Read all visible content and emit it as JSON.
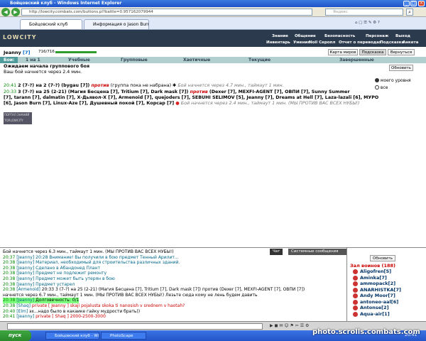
{
  "window": {
    "title": "Бойцовский клуб - Windows Internet Explorer"
  },
  "address": {
    "url": "http://lowcity.combats.com/buttons.pl?battle=0.957162079944",
    "search_placeholder": "Яндекс"
  },
  "tabs": [
    {
      "label": "Бойцовский клуб"
    },
    {
      "label": "Информация о Jason Burn"
    }
  ],
  "game": {
    "logo": "LOWCITY",
    "top_links": [
      "Знание",
      "Общение",
      "Безопасность",
      "Персонаж",
      "Выход",
      "Инвентарь",
      "Умения",
      "Noil Серопл",
      "Отчет о переводах",
      "Подсказка",
      "Анкета"
    ],
    "player": {
      "name": "Jeanny",
      "level": "[7]",
      "hp": "716/716",
      "hp_fraction": 1.0
    },
    "buttons": {
      "map": "Карта миров",
      "hint": "Подсказка",
      "back": "Вернуться",
      "refresh": "Обновить"
    },
    "fight_tabs": [
      "Бои:",
      "1 на 1",
      "Учебные",
      "Групповые",
      "Хаотичные",
      "Текущие",
      "Завершенные"
    ],
    "status_title": "Ожидаем начала группового боя",
    "status_sub": "Ваш бой начнется через 2.4 мин.",
    "radio": {
      "opt1": "моего уровня",
      "opt2": "все"
    },
    "battle1": {
      "time": "20:41",
      "text": "2 (7-?) на 2 (7-?) (bygau [7]) ",
      "against": "против",
      "rest": " (группа пока не набрана) ",
      "timer": "Бой начнется через 4.7 мин., таймаут 1 мин."
    },
    "battle2_l1": {
      "time": "20:33",
      "text": "3 (7-?) на 25 (2-21) (Магия Бесцена [7], Tritium [7], Dark mask [7]) ",
      "against": "против",
      "rest": " (Dexer [7], MEXFI-AGENT [7], ОВПИ [7], Sunny Summer"
    },
    "battle2_l2": "[7], tarann [7], dalmatin [7], Х-Дьявол-Х [7], Armenoid [7], quejoders [7], SEBUHI SELIMOV [5], Jeanny [7], Dreams at Hell [7], Laza-lazali [6], МУРО",
    "battle2_l3": {
      "text": "[6], Jason Burn [7], Linux-Aze [7], Душевный покой [7], Корсар [7] ",
      "timer": "Бой начнется через 2.4 мин., таймаут 1 мин. (МЫ ПРОТИВ ВАС ВСЕХ НУБЫ!)"
    },
    "counter": "ПОРТАЛ ЗНАНИЙ\nTOP.LOWCITY"
  },
  "chat": {
    "tabs": [
      "Чат",
      "Системные сообщения"
    ],
    "lines": [
      {
        "ts": "",
        "who": "",
        "text": "Бой начнется через 6.3 мин., таймаут 1 мин. (МЫ ПРОТИВ ВАС ВСЕХ НУБЫ!)"
      },
      {
        "ts": "20:37",
        "who": "[Jeanny]",
        "text": "20:28 Внимание! Вы получили в бою предмет Тенный Арилит..."
      },
      {
        "ts": "20:38",
        "who": "[Jeanny]",
        "text": "Материал, необходимый для строительства различных зданий."
      },
      {
        "ts": "20:38",
        "who": "[Jeanny]",
        "text": "Сделано в Абандонед Плант"
      },
      {
        "ts": "20:38",
        "who": "[Jeanny]",
        "text": "Предмет не подлежит ремонту"
      },
      {
        "ts": "20:38",
        "who": "[Jeanny]",
        "text": "Предмет может быть утерян в бою"
      },
      {
        "ts": "20:38",
        "who": "[Jeanny]",
        "text": "Предмет устарел"
      },
      {
        "ts": "20:38",
        "who": "[Armenoid]",
        "text": "20:33 3 (7-?) на 25 (2-21) (Магия Бесцена [7], Tritium [7], Dark mask [7]) против (Dexer [7], MEXFI-AGENT [7], ОВПИ [7])"
      },
      {
        "ts": "",
        "who": "",
        "text": "начнется через 6.7 мин., таймаут 1 мин. (МЫ ПРОТИВ ВАС ВСЕХ НУБЫ!) Лезьте сюда кому не лень будем давить"
      },
      {
        "ts": "20:38",
        "who": "[Jeanny]",
        "text": "Долговечность: 0/1"
      },
      {
        "ts": "20:38",
        "who": "[Shaq]",
        "text": "private [ Jeanny ] skaji pojalusta skoka ti nanosish v srednem v haotah?"
      },
      {
        "ts": "20:40",
        "who": "[Elm]",
        "text": "эх...надо было в какаике гайку мудрости брать))"
      },
      {
        "ts": "20:41",
        "who": "[Jeanny]",
        "text": "private [ Shaq ] 2000-2500-3000"
      }
    ]
  },
  "users": {
    "refresh": "Обновить",
    "title": "Зал воинов (188)",
    "list": [
      "Aligofren[5]",
      "Aminka[7]",
      "ammopack[2]",
      "ANARHISTKA[7]",
      "Andy Moor[7]",
      "antoneo-aal[6]",
      "Antonse[2]",
      "Aqua-air[1]"
    ]
  },
  "taskbar": {
    "start": "пуск",
    "tasks": [
      "Бойцовский клуб - Wi...",
      "PhotoScape"
    ],
    "clock": "20:41"
  },
  "watermark": "photo.scrolls.combats.com"
}
